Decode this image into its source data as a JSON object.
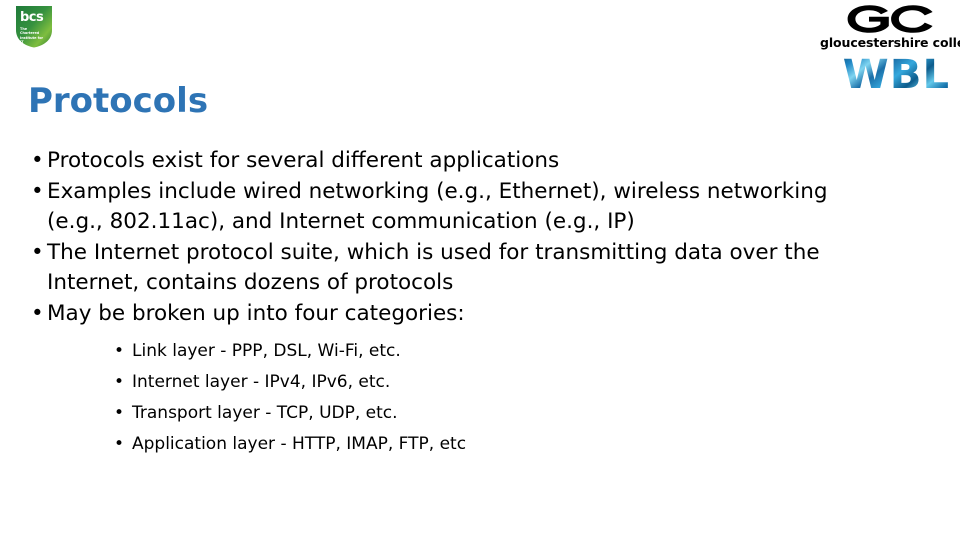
{
  "slide": {
    "title": "Protocols",
    "title_color": "#2E74B5",
    "background_color": "#FFFFFF"
  },
  "logos": {
    "bcs": {
      "name": "bcs-logo",
      "wordmark": "bcs",
      "tagline": "The Chartered Institute for IT",
      "shield_color_top": "#1F7A3A",
      "shield_color_bottom": "#8CC63F"
    },
    "gloucestershire_college": {
      "name": "gc-logo",
      "monogram": "GC",
      "wordmark": "gloucestershire college",
      "color": "#000000"
    },
    "wbl": {
      "name": "wbl-logo",
      "text": "WBL",
      "color": "#1F86C4"
    }
  },
  "content": {
    "bullet_char": "•",
    "bullets": [
      {
        "text": "Protocols exist for several different applications",
        "sub_bullets": []
      },
      {
        "text": "Examples include wired networking (e.g., Ethernet), wireless networking (e.g., 802.11ac), and Internet communication (e.g., IP)",
        "sub_bullets": []
      },
      {
        "text": "The Internet protocol suite, which is used for transmitting data over the Internet, contains dozens of protocols",
        "sub_bullets": []
      },
      {
        "text": "May be broken up into four categories:",
        "sub_bullets": [
          "Link layer - PPP, DSL, Wi-Fi, etc.",
          "Internet layer - IPv4, IPv6, etc.",
          "Transport layer - TCP, UDP, etc.",
          "Application layer - HTTP, IMAP, FTP, etc"
        ]
      }
    ]
  }
}
